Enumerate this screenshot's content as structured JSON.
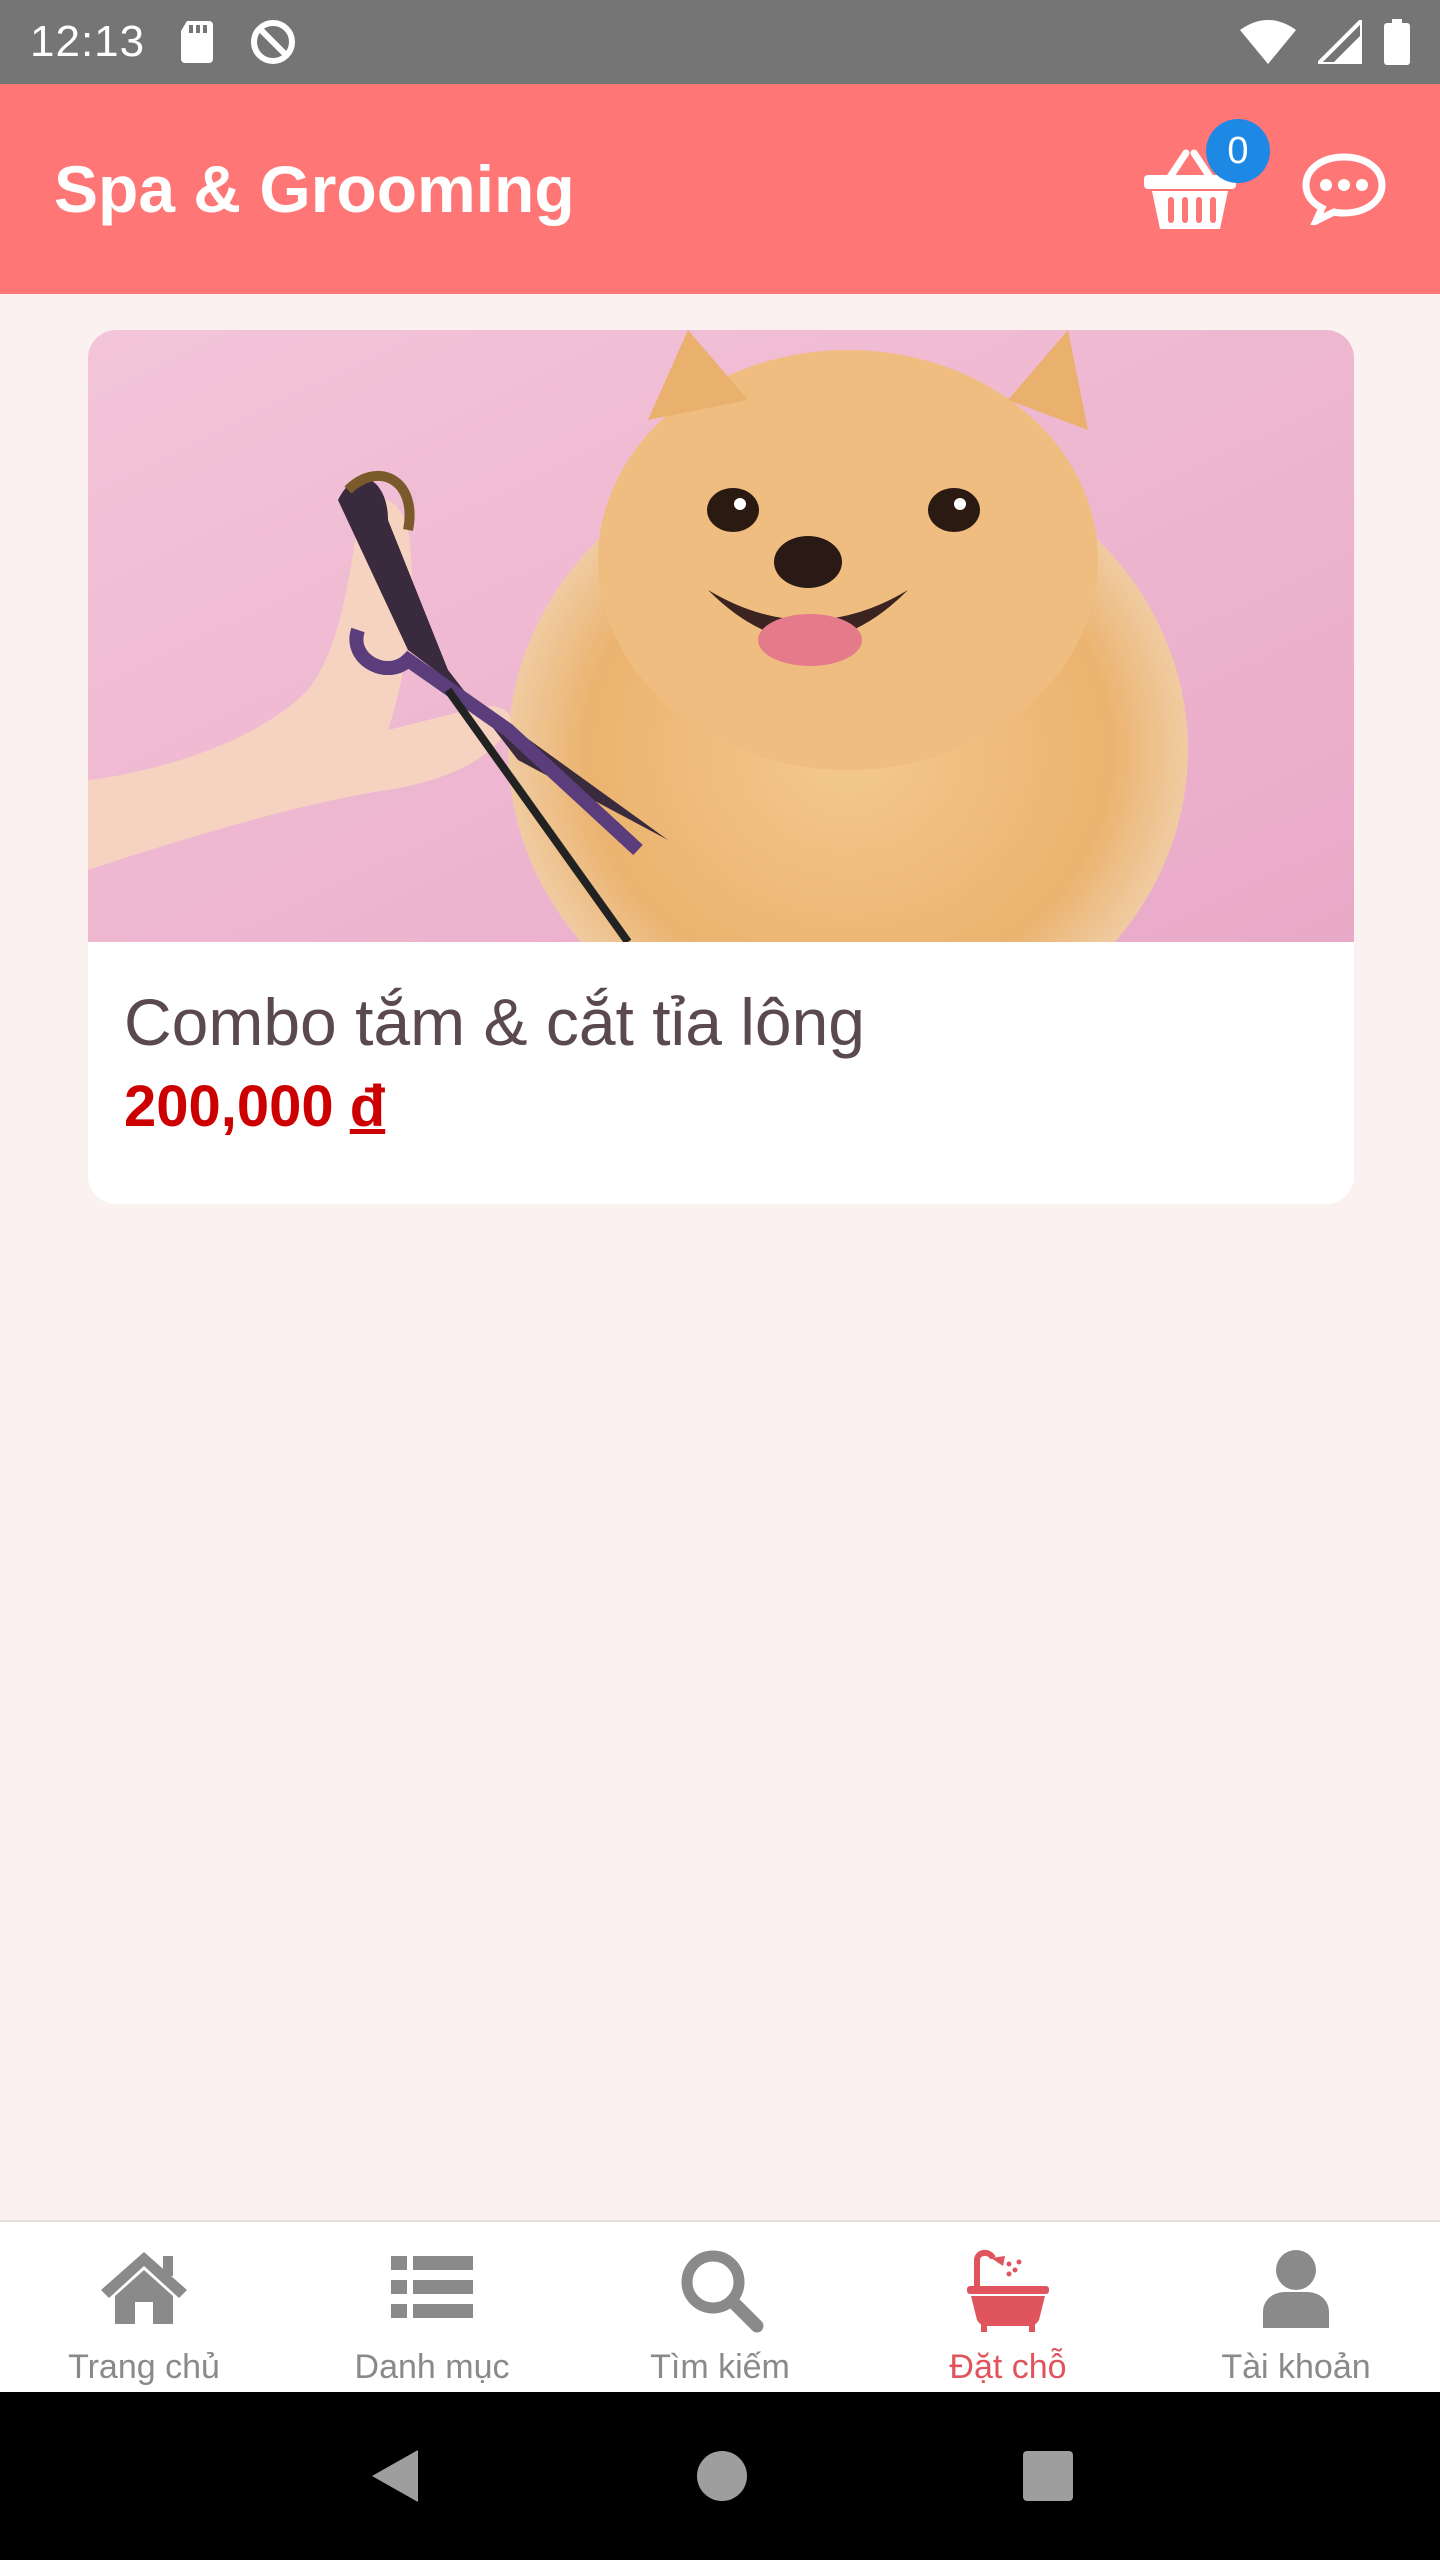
{
  "status_bar": {
    "time": "12:13",
    "icons": [
      "sd-card-icon",
      "data-saver-icon",
      "wifi-icon",
      "signal-icon",
      "battery-icon"
    ]
  },
  "app_bar": {
    "title": "Spa & Grooming",
    "cart_count": "0",
    "background": "#ff7676"
  },
  "card": {
    "title": "Combo tắm & cắt tỉa lông",
    "price": "200,000",
    "currency": "đ",
    "image": "pomeranian-grooming-photo"
  },
  "bottom_nav": {
    "items": [
      {
        "label": "Trang chủ",
        "icon": "home-icon"
      },
      {
        "label": "Danh mục",
        "icon": "list-icon"
      },
      {
        "label": "Tìm kiếm",
        "icon": "search-icon"
      },
      {
        "label": "Đặt chỗ",
        "icon": "bathtub-icon"
      },
      {
        "label": "Tài khoản",
        "icon": "user-icon"
      }
    ],
    "active_index": 3,
    "active_color": "#e0555d"
  }
}
